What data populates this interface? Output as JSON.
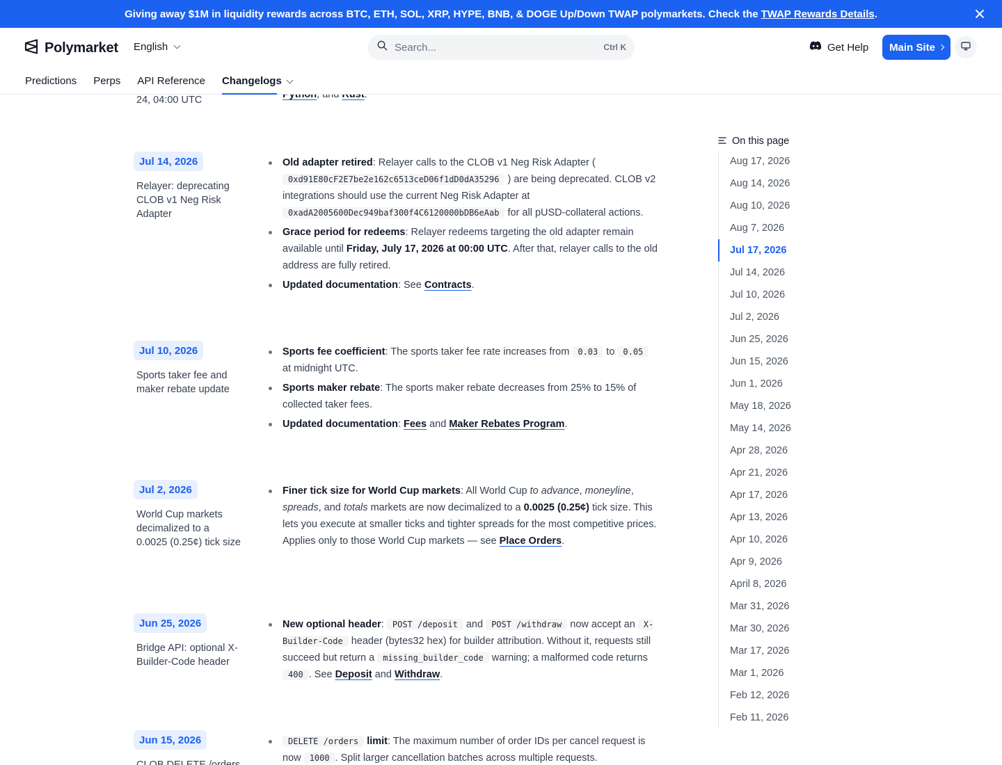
{
  "banner": {
    "text": "Giving away $1M in liquidity rewards across BTC, ETH, SOL, XRP, HYPE, BNB, & DOGE Up/Down TWAP polymarkets. Check the",
    "link": "TWAP Rewards Details",
    "suffix": "."
  },
  "header": {
    "logo_text": "Polymarket",
    "language": "English",
    "search_placeholder": "Search...",
    "search_shortcut": "Ctrl K",
    "help_label": "Get Help",
    "main_site_label": "Main Site",
    "tabs": [
      {
        "label": "Predictions"
      },
      {
        "label": "Perps"
      },
      {
        "label": "API Reference"
      },
      {
        "label": "Changelogs"
      }
    ]
  },
  "top_fragment": {
    "date_text": "24, 04:00 UTC",
    "link1": "Python",
    "mid": ", and ",
    "link2": "Rust",
    "end": "."
  },
  "entries": [
    {
      "date": "Jul 14, 2026",
      "title": "Relayer: deprecating CLOB v1 Neg Risk Adapter",
      "b1_label": "Old adapter retired",
      "b1_t1": ": Relayer calls to the CLOB v1 Neg Risk Adapter (",
      "b1_code1": "0xd91E80cF2E7be2e162c6513ceD06f1dD0dA35296",
      "b1_t2": ") are being deprecated. CLOB v2 integrations should use the current Neg Risk Adapter at",
      "b1_code2": "0xadA2005600Dec949baf300f4C6120000bDB6eAab",
      "b1_t3": "for all pUSD-collateral actions.",
      "b2_label": "Grace period for redeems",
      "b2_t1": ": Relayer redeems targeting the old adapter remain available until",
      "b2_bold": "Friday, July 17, 2026 at 00:00 UTC",
      "b2_t2": ". After that, relayer calls to the old address are fully retired.",
      "b3_label": "Updated documentation",
      "b3_t1": ": See",
      "b3_link": "Contracts",
      "b3_end": "."
    },
    {
      "date": "Jul 10, 2026",
      "title": "Sports taker fee and maker rebate update",
      "b1_label": "Sports fee coefficient",
      "b1_t1": ": The sports taker fee rate increases from",
      "b1_code1": "0.03",
      "b1_t2": "to",
      "b1_code2": "0.05",
      "b1_t3": "at midnight UTC.",
      "b2_label": "Sports maker rebate",
      "b2_t1": ": The sports maker rebate decreases from 25% to 15% of collected taker fees.",
      "b3_label": "Updated documentation",
      "b3_t1": ":",
      "b3_link1": "Fees",
      "b3_and": "and",
      "b3_link2": "Maker Rebates Program",
      "b3_end": "."
    },
    {
      "date": "Jul 2, 2026",
      "title": "World Cup markets decimalized to a 0.0025 (0.25¢) tick size",
      "b1_label": "Finer tick size for World Cup markets",
      "b1_t1": ": All World Cup",
      "b1_i1": "to advance",
      "b1_c1": ",",
      "b1_i2": "moneyline",
      "b1_c2": ",",
      "b1_i3": "spreads",
      "b1_c3": ", and",
      "b1_i4": "totals",
      "b1_t2": "markets are now decimalized to a",
      "b1_bold": "0.0025 (0.25¢)",
      "b1_t3": "tick size. This lets you execute at smaller ticks and tighter spreads for the most competitive prices. Applies only to those World Cup markets — see",
      "b1_link": "Place Orders",
      "b1_end": "."
    },
    {
      "date": "Jun 25, 2026",
      "title": "Bridge API: optional X-Builder-Code header",
      "b1_label": "New optional header",
      "b1_t1": ":",
      "b1_code1": "POST /deposit",
      "b1_and": "and",
      "b1_code2": "POST /withdraw",
      "b1_t2": "now accept an",
      "b1_code3": "X-Builder-Code",
      "b1_t3": "header (bytes32 hex) for builder attribution. Without it, requests still succeed but return a",
      "b1_code4": "missing_builder_code",
      "b1_t4": "warning; a malformed code returns",
      "b1_code5": "400",
      "b1_t5": ". See",
      "b1_link1": "Deposit",
      "b1_and2": "and",
      "b1_link2": "Withdraw",
      "b1_end": "."
    },
    {
      "date": "Jun 15, 2026",
      "title": "CLOB DELETE /orders",
      "b1_code1": "DELETE /orders",
      "b1_label": "limit",
      "b1_t1": ": The maximum number of order IDs per cancel request is now",
      "b1_code2": "1000",
      "b1_t2": ". Split larger cancellation batches across multiple requests."
    }
  ],
  "toc": {
    "heading": "On this page",
    "items": [
      {
        "label": "Aug 17, 2026"
      },
      {
        "label": "Aug 14, 2026"
      },
      {
        "label": "Aug 10, 2026"
      },
      {
        "label": "Aug 7, 2026"
      },
      {
        "label": "Jul 17, 2026",
        "active": true
      },
      {
        "label": "Jul 14, 2026"
      },
      {
        "label": "Jul 10, 2026"
      },
      {
        "label": "Jul 2, 2026"
      },
      {
        "label": "Jun 25, 2026"
      },
      {
        "label": "Jun 15, 2026"
      },
      {
        "label": "Jun 1, 2026"
      },
      {
        "label": "May 18, 2026"
      },
      {
        "label": "May 14, 2026"
      },
      {
        "label": "Apr 28, 2026"
      },
      {
        "label": "Apr 21, 2026"
      },
      {
        "label": "Apr 17, 2026"
      },
      {
        "label": "Apr 13, 2026"
      },
      {
        "label": "Apr 10, 2026"
      },
      {
        "label": "Apr 9, 2026"
      },
      {
        "label": "April 8, 2026"
      },
      {
        "label": "Mar 31, 2026"
      },
      {
        "label": "Mar 30, 2026"
      },
      {
        "label": "Mar 17, 2026"
      },
      {
        "label": "Mar 1, 2026"
      },
      {
        "label": "Feb 12, 2026"
      },
      {
        "label": "Feb 11, 2026"
      }
    ]
  },
  "colors": {
    "brand": "#1b62f0",
    "badge_bg": "#e8effd",
    "text": "#111827",
    "muted": "#374151"
  }
}
